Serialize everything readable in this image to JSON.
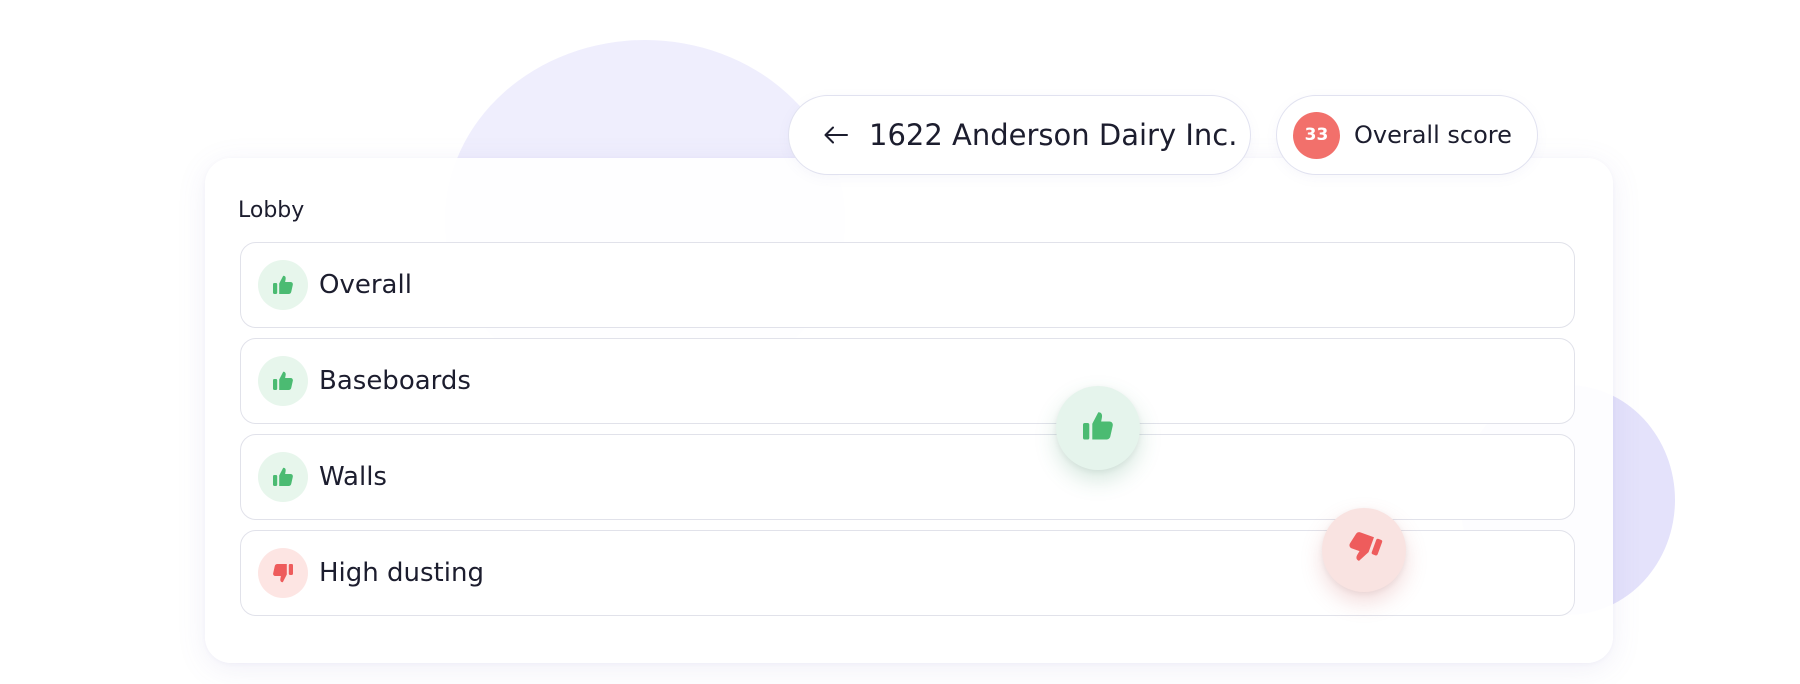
{
  "header": {
    "address_title": "1622 Anderson Dairy Inc.",
    "back_icon": "arrow-left-icon",
    "score_value": "33",
    "score_label": "Overall score"
  },
  "section": {
    "title": "Lobby",
    "items": [
      {
        "label": "Overall",
        "rating": "thumbs-up"
      },
      {
        "label": "Baseboards",
        "rating": "thumbs-up"
      },
      {
        "label": "Walls",
        "rating": "thumbs-up"
      },
      {
        "label": "High dusting",
        "rating": "thumbs-down"
      }
    ]
  },
  "floating_actions": {
    "up_icon": "thumbs-up-icon",
    "down_icon": "thumbs-down-icon"
  },
  "colors": {
    "positive": "#4bbb72",
    "negative": "#ee5c5c",
    "score_badge": "#f2706b",
    "text": "#1c1d2e",
    "row_border": "#e1e2ea",
    "background_blob": "#efeefd"
  }
}
